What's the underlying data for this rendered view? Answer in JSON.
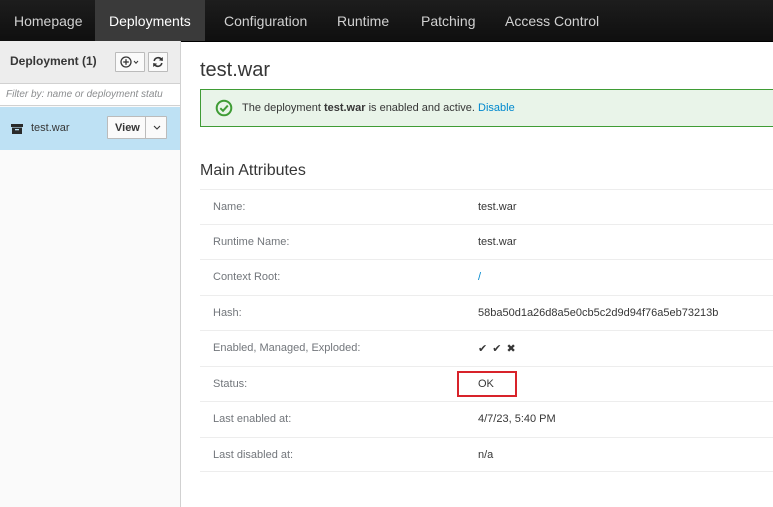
{
  "nav": {
    "tabs": [
      {
        "label": "Homepage"
      },
      {
        "label": "Deployments",
        "active": true
      },
      {
        "label": "Configuration"
      },
      {
        "label": "Runtime"
      },
      {
        "label": "Patching"
      },
      {
        "label": "Access Control"
      }
    ]
  },
  "sidebar": {
    "title": "Deployment (1)",
    "add_icon": "plus-circle-icon",
    "refresh_icon": "refresh-icon",
    "filter_placeholder": "Filter by: name or deployment statu",
    "items": [
      {
        "name": "test.war",
        "icon": "archive-icon",
        "view_label": "View"
      }
    ]
  },
  "main": {
    "title": "test.war",
    "alert": {
      "prefix": "The deployment ",
      "name": "test.war",
      "suffix": " is enabled and active. ",
      "link": "Disable",
      "color": "#3f9c35"
    },
    "section_title": "Main Attributes",
    "attributes": [
      {
        "label": "Name:",
        "value": "test.war"
      },
      {
        "label": "Runtime Name:",
        "value": "test.war"
      },
      {
        "label": "Context Root:",
        "value": "/"
      },
      {
        "label": "Hash:",
        "value": "58ba50d1a26d8a5e0cb5c2d9d94f76a5eb73213b"
      },
      {
        "label": "Enabled, Managed, Exploded:",
        "value": "✔ ✔ ✖"
      },
      {
        "label": "Status:",
        "value": "OK"
      },
      {
        "label": "Last enabled at:",
        "value": "4/7/23, 5:40 PM"
      },
      {
        "label": "Last disabled at:",
        "value": "n/a"
      }
    ],
    "highlight_color": "#d8232a"
  }
}
